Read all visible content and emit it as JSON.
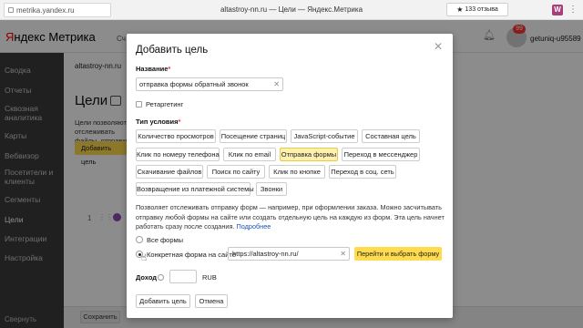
{
  "browser": {
    "url": "metrika.yandex.ru",
    "tab_title": "altastroy-nn.ru — Цели — Яндекс.Метрика",
    "rating": "133 отзыва",
    "ext_label": "W"
  },
  "header": {
    "logo_brand": "Я",
    "logo_rest": "ндекс Метрика",
    "link": "Сч",
    "notifications_count": "99",
    "username": "getuniq-u95589"
  },
  "sidebar": {
    "items": [
      {
        "label": "Сводка"
      },
      {
        "label": "Отчеты"
      },
      {
        "label": "Сквозная аналитика"
      },
      {
        "label": "Карты"
      },
      {
        "label": "Вебвизор"
      },
      {
        "label": "Посетители и клиенты"
      },
      {
        "label": "Сегменты"
      },
      {
        "label": "Цели"
      },
      {
        "label": "Интеграции"
      },
      {
        "label": "Настройка"
      }
    ],
    "collapse_label": "Свернуть"
  },
  "page": {
    "counter": "altastroy-nn.ru",
    "title": "Цели",
    "description": "Цели позволяют отслеживать файлы, отправку",
    "add_button": "Добавить цель",
    "row_number": "1",
    "save_button": "Сохранить"
  },
  "modal": {
    "title": "Добавить цель",
    "name_label": "Название",
    "name_value": "отправка формы обратный звонок",
    "retargeting_label": "Ретаргетинг",
    "condition_type_label": "Тип условия",
    "conditions": [
      {
        "label": "Количество просмотров",
        "selected": false
      },
      {
        "label": "Посещение страниц",
        "selected": false
      },
      {
        "label": "JavaScript-событие",
        "selected": false
      },
      {
        "label": "Составная цель",
        "selected": false
      },
      {
        "label": "Клик по номеру телефона",
        "selected": false
      },
      {
        "label": "Клик по email",
        "selected": false
      },
      {
        "label": "Отправка формы",
        "selected": true
      },
      {
        "label": "Переход в мессенджер",
        "selected": false
      },
      {
        "label": "Скачивание файлов",
        "selected": false
      },
      {
        "label": "Поиск по сайту",
        "selected": false
      },
      {
        "label": "Клик по кнопке",
        "selected": false
      },
      {
        "label": "Переход в соц. сеть",
        "selected": false
      },
      {
        "label": "Возвращение из платежной системы",
        "selected": false
      },
      {
        "label": "Звонки",
        "selected": false
      }
    ],
    "help_text": "Позволяет отслеживать отправку форм — например, при оформлении заказа. Можно засчитывать отправку любой формы на сайте или создать отдельную цель на каждую из форм. Эта цель начнет работать сразу после создания.",
    "help_link": "Подробнее",
    "radio_all": "Все формы",
    "radio_specific": "Конкретная форма на сайте",
    "form_url": "https://altastroy-nn.ru/",
    "go_button": "Перейти и выбрать форму",
    "income_label": "Доход",
    "currency": "RUB",
    "submit_button": "Добавить цель",
    "cancel_button": "Отмена"
  }
}
